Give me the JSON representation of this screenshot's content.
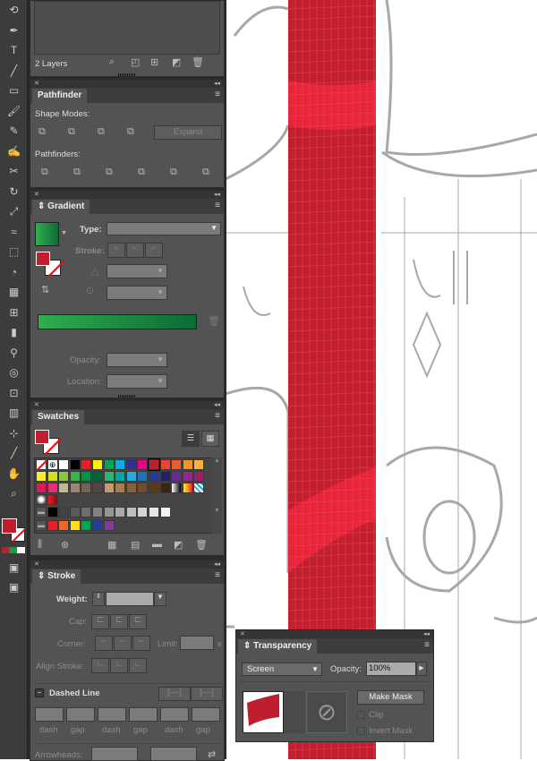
{
  "layers": {
    "count_label": "2 Layers"
  },
  "pathfinder": {
    "title": "Pathfinder",
    "shape_modes_label": "Shape Modes:",
    "expand_label": "Expand",
    "pathfinders_label": "Pathfinders:"
  },
  "gradient": {
    "title": "Gradient",
    "type_label": "Type:",
    "stroke_label": "Stroke:",
    "opacity_label": "Opacity:",
    "location_label": "Location:",
    "start_color": "#2fae4f",
    "end_color": "#0c6b37"
  },
  "swatches": {
    "title": "Swatches",
    "fill_color": "#be1e2d",
    "rows": [
      [
        "none",
        "registration",
        "#ffffff",
        "#000000",
        "#ed1c24",
        "#fff200",
        "#00a651",
        "#00aeef",
        "#2e3192",
        "#ec008c",
        "#be1e2d",
        "#ef4136",
        "#f15a29",
        "#f7941d",
        "#fbb040"
      ],
      [
        "#f9ed32",
        "#d7df23",
        "#8dc63f",
        "#39b54a",
        "#009444",
        "#006838",
        "#2bb673",
        "#00a79d",
        "#27aae1",
        "#1c75bc",
        "#2b3990",
        "#262262",
        "#662d91",
        "#92278f",
        "#9e1f63"
      ],
      [
        "#da1c5c",
        "#ee2a7b",
        "#c2b59b",
        "#998675",
        "#736357",
        "#534741",
        "#c49a6c",
        "#a97c50",
        "#8b5e3c",
        "#754c29",
        "#603913",
        "#3c2415",
        "gradient-bw",
        "gradient-orange",
        "gradient-blue"
      ],
      [
        "pattern",
        "gradient-red"
      ],
      [
        "folder",
        "#000000",
        "#414042",
        "#58595b",
        "#6d6e71",
        "#808285",
        "#939598",
        "#a7a9ac",
        "#bcbec0",
        "#d1d3d4",
        "#e6e7e8",
        "#f1f2f2"
      ],
      [
        "folder",
        "#ed1c24",
        "#f26522",
        "#ffde17",
        "#00a651",
        "#21409a",
        "#7f3f98"
      ]
    ]
  },
  "stroke": {
    "title": "Stroke",
    "weight_label": "Weight:",
    "cap_label": "Cap:",
    "corner_label": "Corner:",
    "limit_label": "Limit:",
    "limit_unit": "x",
    "align_label": "Align Stroke:",
    "dashed_label": "Dashed Line",
    "dash_labels": [
      "dash",
      "gap",
      "dash",
      "gap",
      "dash",
      "gap"
    ],
    "arrowheads_label": "Arrowheads:"
  },
  "transparency": {
    "title": "Transparency",
    "blend_mode": "Screen",
    "opacity_label": "Opacity:",
    "opacity_value": "100%",
    "make_mask_label": "Make Mask",
    "clip_label": "Clip",
    "invert_mask_label": "Invert Mask"
  },
  "colors": {
    "stripe": "#c41f2e",
    "stripe_band": "#e8253a",
    "fill": "#be1e2d"
  }
}
